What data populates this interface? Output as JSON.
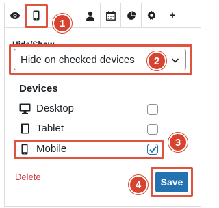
{
  "tabs": [
    {
      "icon": "eye-icon"
    },
    {
      "icon": "mobile-icon",
      "active": true
    },
    {
      "icon": "user-icon"
    },
    {
      "icon": "calendar-icon"
    },
    {
      "icon": "pie-chart-icon"
    },
    {
      "icon": "gear-icon"
    },
    {
      "icon": "plus-icon",
      "text": "+"
    }
  ],
  "hide_show": {
    "label": "Hide/Show",
    "selected": "Hide on checked devices"
  },
  "devices": {
    "title": "Devices",
    "items": [
      {
        "label": "Desktop",
        "icon": "desktop-icon",
        "checked": false
      },
      {
        "label": "Tablet",
        "icon": "tablet-icon",
        "checked": false
      },
      {
        "label": "Mobile",
        "icon": "mobile-icon",
        "checked": true
      }
    ]
  },
  "actions": {
    "delete_label": "Delete",
    "save_label": "Save"
  },
  "annotations": [
    "1",
    "2",
    "3",
    "4"
  ],
  "colors": {
    "highlight": "#e0533f",
    "badge": "#d8432f",
    "primary": "#2271b1",
    "delete": "#d63638"
  }
}
